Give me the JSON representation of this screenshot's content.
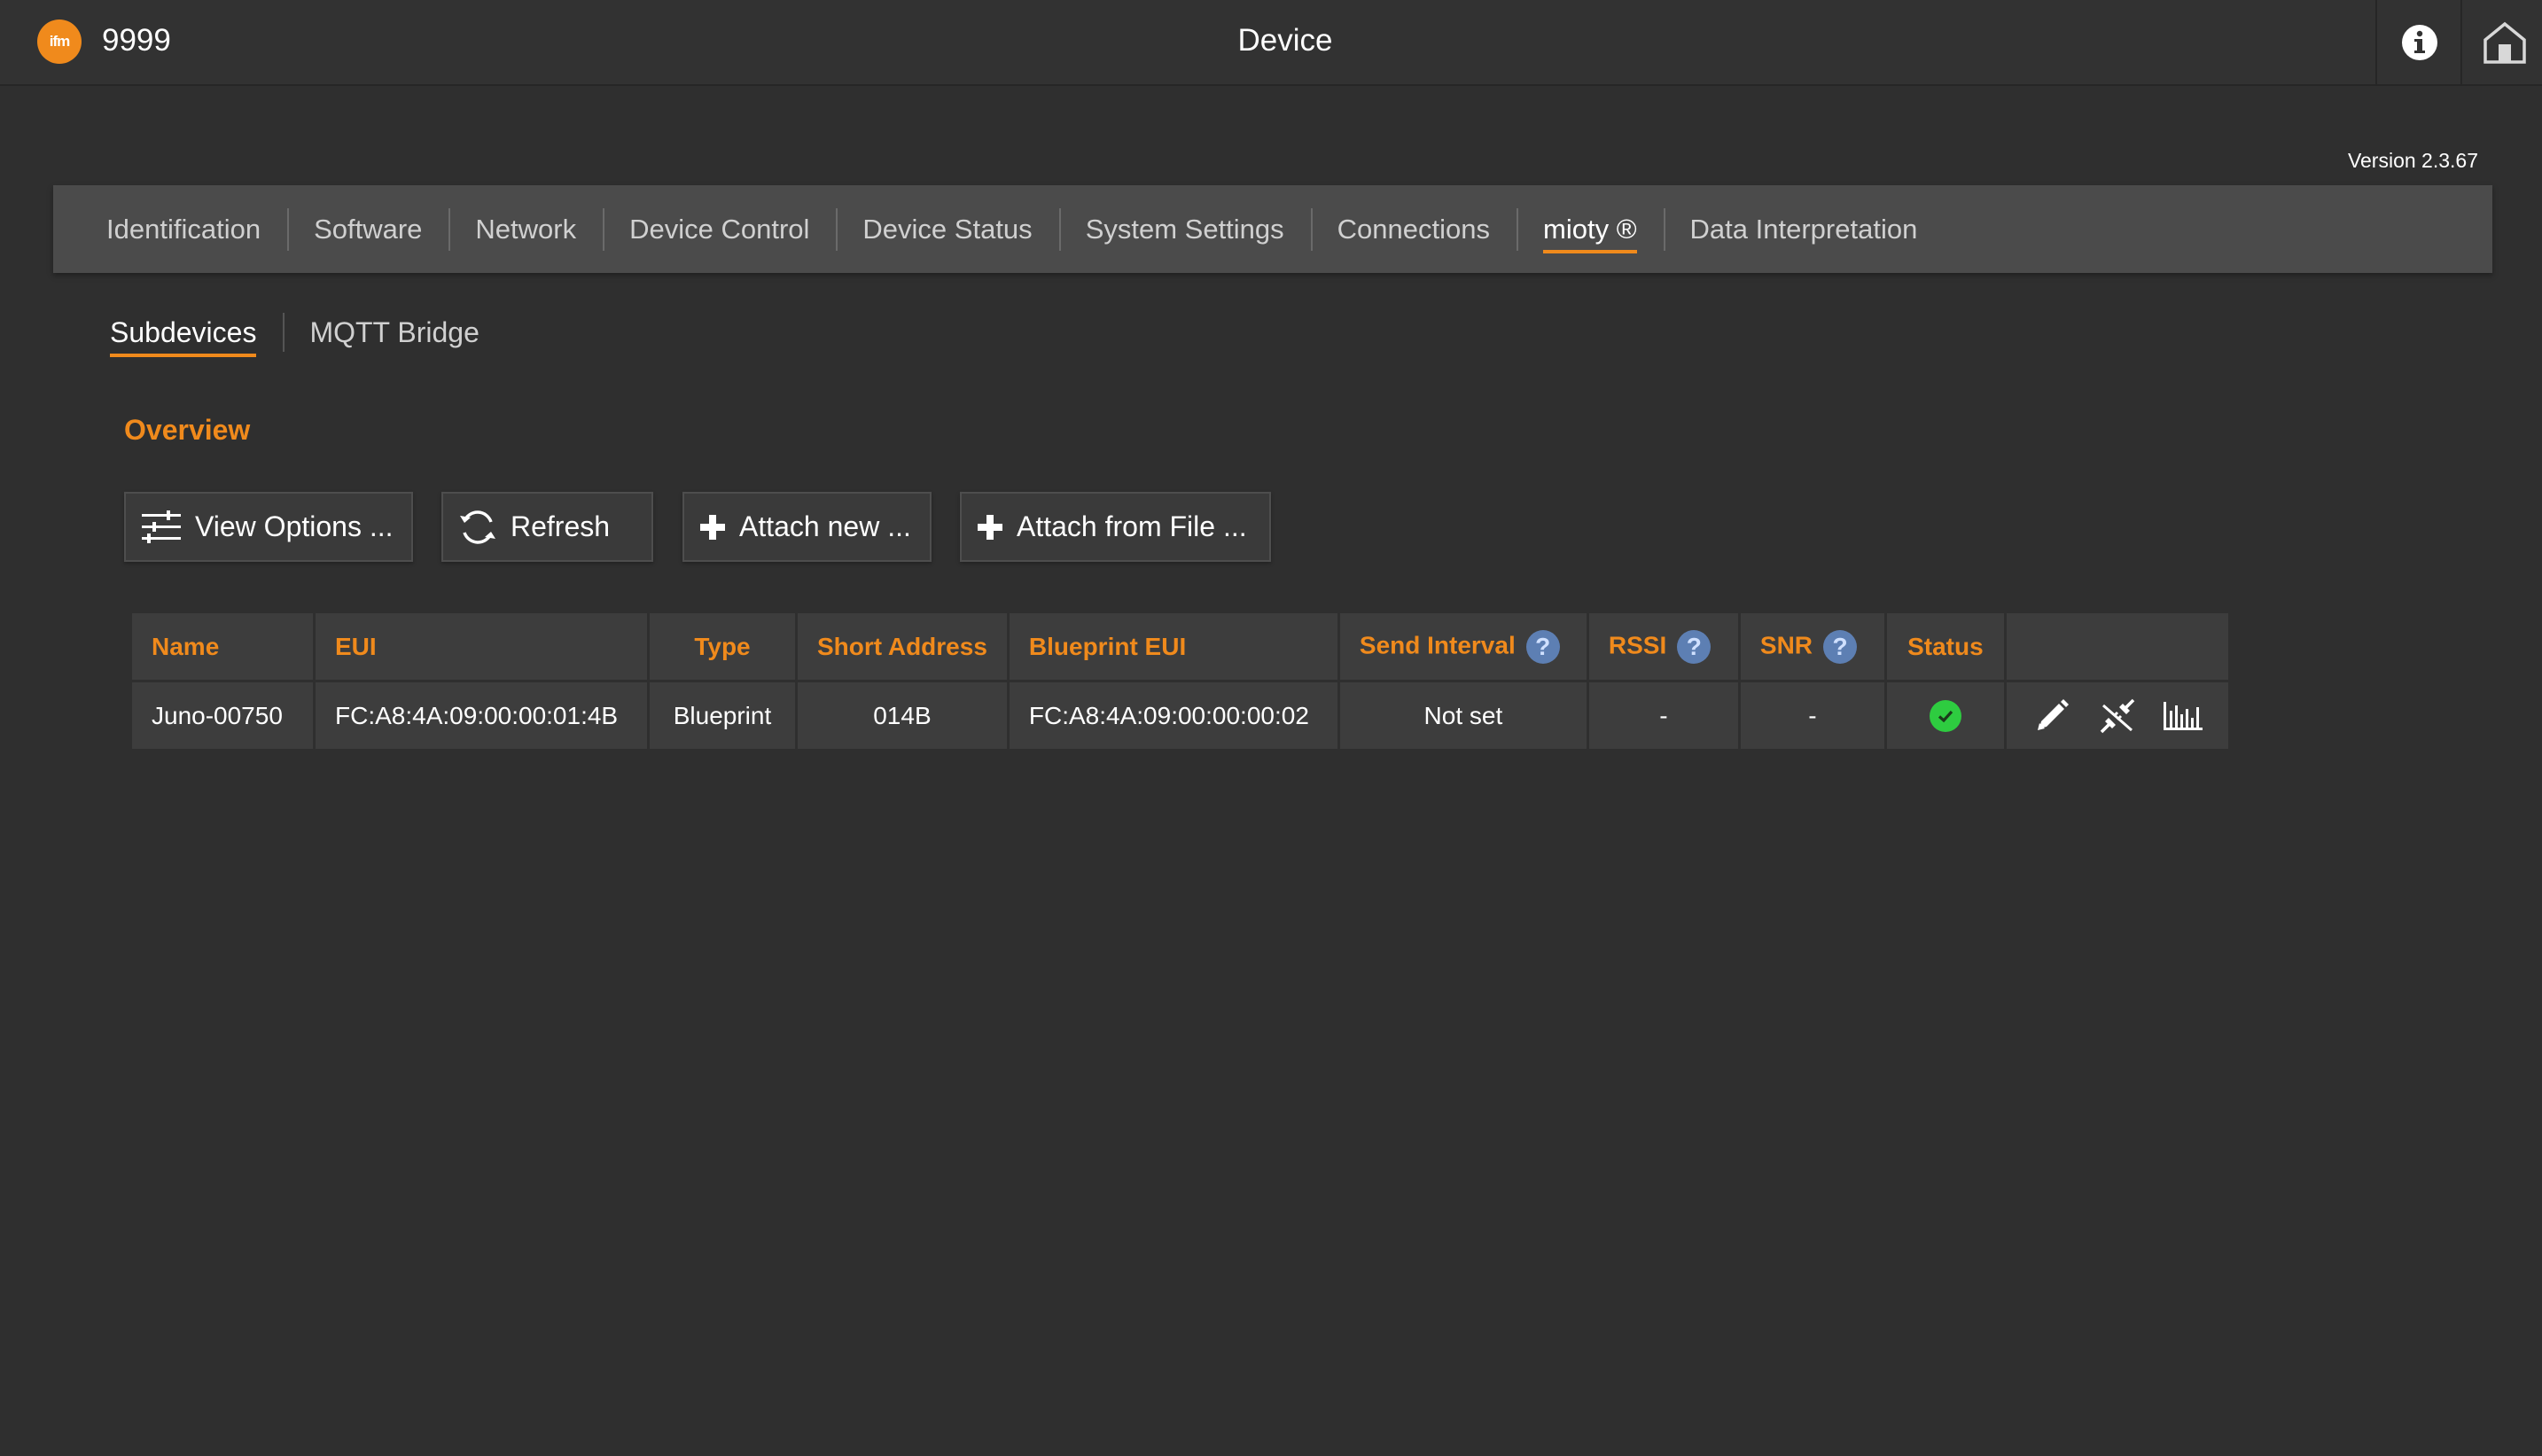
{
  "header": {
    "device_id": "9999",
    "title": "Device",
    "logo_text": "ifm"
  },
  "version": "Version 2.3.67",
  "main_tabs": [
    {
      "label": "Identification"
    },
    {
      "label": "Software"
    },
    {
      "label": "Network"
    },
    {
      "label": "Device Control"
    },
    {
      "label": "Device Status"
    },
    {
      "label": "System Settings"
    },
    {
      "label": "Connections"
    },
    {
      "label": "mioty ®",
      "active": true
    },
    {
      "label": "Data Interpretation"
    }
  ],
  "sub_tabs": [
    {
      "label": "Subdevices",
      "active": true
    },
    {
      "label": "MQTT Bridge"
    }
  ],
  "section_title": "Overview",
  "toolbar": {
    "view_options": "View Options ...",
    "refresh": "Refresh",
    "attach_new": "Attach new ...",
    "attach_from_file": "Attach from File ..."
  },
  "table": {
    "columns": {
      "name": "Name",
      "eui": "EUI",
      "type": "Type",
      "short_address": "Short Address",
      "blueprint_eui": "Blueprint EUI",
      "send_interval": "Send Interval",
      "rssi": "RSSI",
      "snr": "SNR",
      "status": "Status"
    },
    "help_symbol": "?",
    "rows": [
      {
        "name": "Juno-00750",
        "eui": "FC:A8:4A:09:00:00:01:4B",
        "type": "Blueprint",
        "short_address": "014B",
        "blueprint_eui": "FC:A8:4A:09:00:00:00:02",
        "send_interval": "Not set",
        "rssi": "-",
        "snr": "-",
        "status": "ok"
      }
    ]
  },
  "colors": {
    "accent": "#f08a1c",
    "background": "#2f2f2f",
    "tab_bar": "#4b4b4b",
    "status_ok": "#2ecc40",
    "help": "#5d7fb3"
  },
  "icons": {
    "logo": "ifm-logo-icon",
    "info": "info-icon",
    "home": "home-icon",
    "view_options": "sliders-icon",
    "refresh": "refresh-icon",
    "attach": "plus-icon",
    "edit": "pencil-icon",
    "detach": "unplug-icon",
    "stats": "bar-chart-icon",
    "status": "check-circle-icon"
  }
}
